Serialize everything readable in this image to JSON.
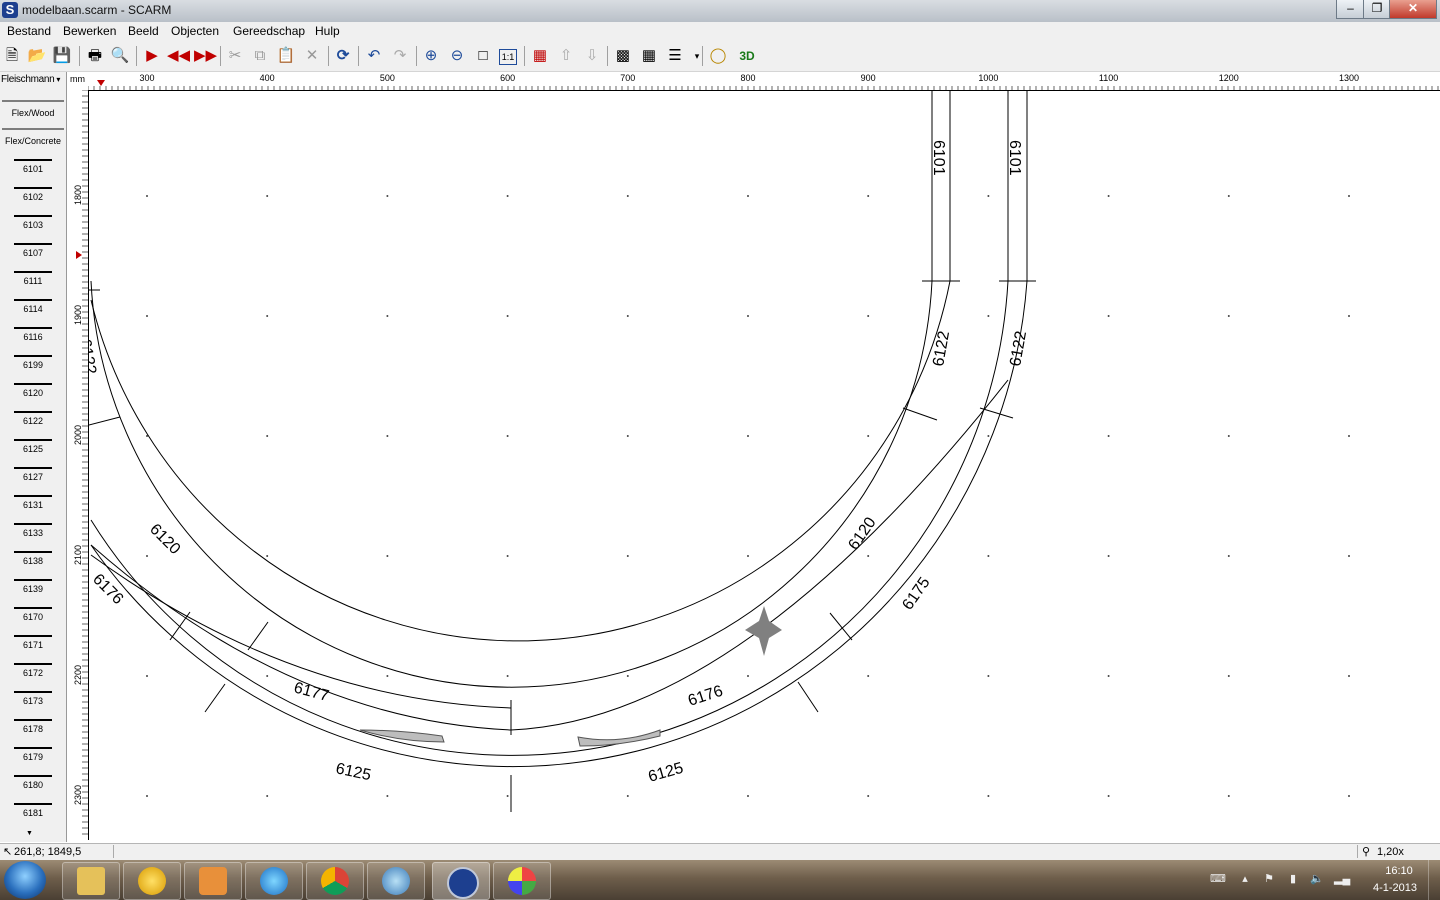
{
  "window": {
    "title": "modelbaan.scarm - SCARM",
    "logo": "S"
  },
  "menu": [
    "Bestand",
    "Bewerken",
    "Beeld",
    "Objecten",
    "Gereedschap",
    "Hulp"
  ],
  "toolbar": {
    "view3d_label": "3D",
    "zoom_actual_label": "1:1"
  },
  "palette": {
    "library": "Fleischmann",
    "groups": [
      "Flex/Wood",
      "Flex/Concrete"
    ],
    "parts": [
      "6101",
      "6102",
      "6103",
      "6107",
      "6111",
      "6114",
      "6116",
      "6199",
      "6120",
      "6122",
      "6125",
      "6127",
      "6131",
      "6133",
      "6138",
      "6139",
      "6170",
      "6171",
      "6172",
      "6173",
      "6178",
      "6179",
      "6180",
      "6181"
    ]
  },
  "ruler": {
    "unit": "mm",
    "x_labels": [
      "300",
      "400",
      "500",
      "600",
      "700",
      "800",
      "900",
      "1000",
      "1100",
      "1200",
      "1300"
    ],
    "y_labels": [
      "1800",
      "1900",
      "2000",
      "2100",
      "2200",
      "2300"
    ]
  },
  "track_labels": {
    "straight": "6101",
    "curve_r2": "6120",
    "curve_r2_short": "6122",
    "curve_r3": "6125",
    "turnout_left": "6176",
    "turnout_right": "6175",
    "turnout_left_2": "6177",
    "partial_left": "6122"
  },
  "status": {
    "coords": "261,8; 1849,5",
    "zoom": "1,20x"
  },
  "taskbar": {
    "apps": [
      "explorer-icon",
      "scarm-e-icon",
      "media-player-icon",
      "ie-icon",
      "chrome-icon",
      "app-5-icon",
      "scarm-icon",
      "paint-icon"
    ],
    "time": "16:10",
    "date": "4-1-2013"
  },
  "colors": {
    "track": "#000000",
    "signal_marker": "#808080",
    "taskbar": "#6e5e4b"
  }
}
